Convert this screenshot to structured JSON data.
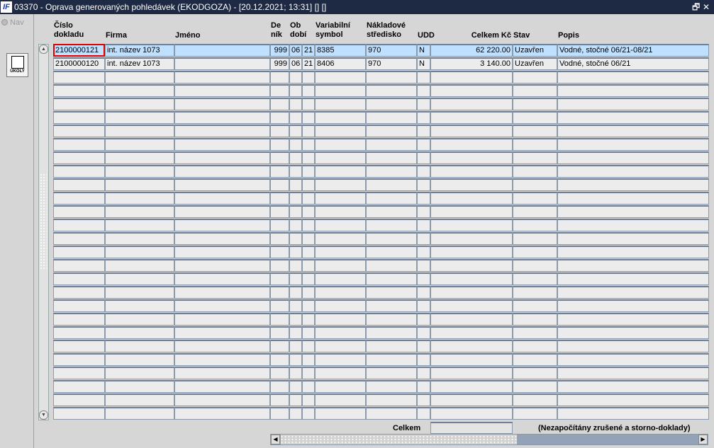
{
  "title": {
    "logo": "IF",
    "text": "03370 - Oprava generovaných pohledávek (EKODGOZA) - [20.12.2021; 13:31]  [] []",
    "restore": "🗗",
    "close": "✕"
  },
  "left": {
    "nav": "Nav",
    "ukoly": "ÚKOLY"
  },
  "headers": {
    "cislo": "Číslo\ndokladu",
    "firma": "Firma",
    "jmeno": "Jméno",
    "denik": "De\nník",
    "obdobi": "Ob\ndobí",
    "vs": "Variabilní\nsymbol",
    "stredisko": "Nákladové\nstředisko",
    "udd": "UDD",
    "celkem": "Celkem Kč",
    "stav": "Stav",
    "popis": "Popis"
  },
  "rows": [
    [
      "2100000121",
      "int. název 1073",
      "",
      "999",
      "06",
      "21",
      "8385",
      "970",
      "N",
      "62 220.00",
      "Uzavřen",
      "Vodné, stočné 06/21-08/21"
    ],
    [
      "2100000120",
      "int. název 1073",
      "",
      "999",
      "06",
      "21",
      "8406",
      "970",
      "N",
      "3 140.00",
      "Uzavřen",
      "Vodné, stočné 06/21"
    ]
  ],
  "empty_rows": 26,
  "footer": {
    "celkem_label": "Celkem",
    "celkem_value": "",
    "note": "(Nezapočítány zrušené a storno-doklady)"
  }
}
